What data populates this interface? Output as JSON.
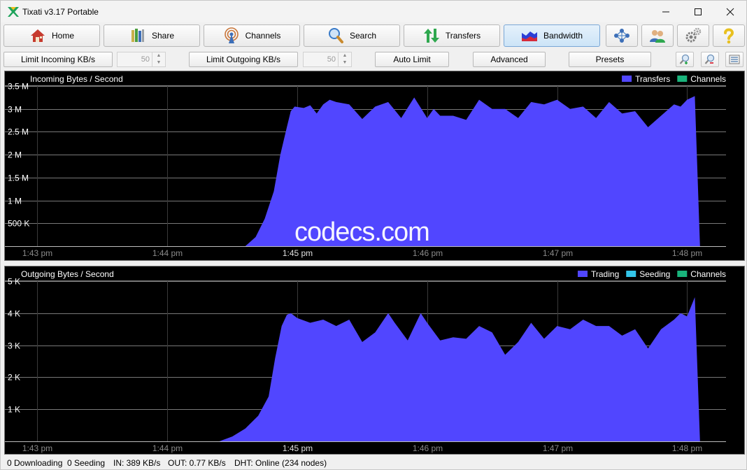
{
  "window": {
    "title": "Tixati v3.17 Portable"
  },
  "toolbar": {
    "buttons": [
      {
        "label": "Home",
        "icon": "house-icon"
      },
      {
        "label": "Share",
        "icon": "books-icon"
      },
      {
        "label": "Channels",
        "icon": "antenna-icon"
      },
      {
        "label": "Search",
        "icon": "magnifier-icon"
      },
      {
        "label": "Transfers",
        "icon": "up-down-arrows-icon"
      },
      {
        "label": "Bandwidth",
        "icon": "bandwidth-chart-icon"
      }
    ],
    "icon_buttons": [
      "network-nodes-icon",
      "users-icon",
      "gears-icon",
      "question-mark-icon"
    ]
  },
  "limits": {
    "incoming_label": "Limit Incoming KB/s",
    "incoming_value": "50",
    "outgoing_label": "Limit Outgoing KB/s",
    "outgoing_value": "50",
    "auto_label": "Auto Limit",
    "advanced_label": "Advanced",
    "presets_label": "Presets"
  },
  "watermark": "codecs.com",
  "colors": {
    "trading": "#5146ff",
    "transfers": "#5146ff",
    "seeding": "#33c5e9",
    "channels": "#19b37b",
    "graph_bg": "#000000",
    "gridline": "#a0a0a0"
  },
  "chart_data": [
    {
      "type": "area",
      "title": "Incoming Bytes / Second",
      "legend": [
        {
          "name": "Transfers",
          "color": "#5146ff"
        },
        {
          "name": "Channels",
          "color": "#19b37b"
        }
      ],
      "legend_position": "top-right",
      "y_ticks": [
        "500 K",
        "1 M",
        "1.5 M",
        "2 M",
        "2.5 M",
        "3 M",
        "3.5 M"
      ],
      "y_tick_values": [
        500000,
        1000000,
        1500000,
        2000000,
        2500000,
        3000000,
        3500000
      ],
      "ylim": [
        0,
        3500000
      ],
      "x_ticks": [
        "1:43 pm",
        "1:44 pm",
        "1:45 pm",
        "1:46 pm",
        "1:47 pm",
        "1:48 pm"
      ],
      "x_minutes": [
        0,
        1,
        2,
        3,
        4,
        5
      ],
      "xlim": [
        -0.25,
        5.3
      ],
      "series": [
        {
          "name": "Transfers",
          "x": [
            -0.25,
            1.6,
            1.68,
            1.75,
            1.82,
            1.87,
            1.92,
            1.95,
            1.98,
            2.05,
            2.1,
            2.15,
            2.2,
            2.25,
            2.3,
            2.4,
            2.5,
            2.6,
            2.7,
            2.8,
            2.9,
            3.0,
            3.05,
            3.1,
            3.2,
            3.3,
            3.4,
            3.5,
            3.6,
            3.7,
            3.8,
            3.9,
            4.0,
            4.1,
            4.2,
            4.3,
            4.4,
            4.5,
            4.6,
            4.7,
            4.8,
            4.9,
            4.95,
            5.0,
            5.06,
            5.1,
            5.3
          ],
          "y": [
            0,
            0,
            200000,
            600000,
            1200000,
            2000000,
            2600000,
            2950000,
            3050000,
            3020000,
            3080000,
            2900000,
            3100000,
            3200000,
            3150000,
            3100000,
            2780000,
            3050000,
            3150000,
            2800000,
            3250000,
            2800000,
            3000000,
            2850000,
            2850000,
            2760000,
            3200000,
            3000000,
            3000000,
            2800000,
            3150000,
            3100000,
            3200000,
            3000000,
            3050000,
            2800000,
            3150000,
            2900000,
            2950000,
            2600000,
            2850000,
            3100000,
            3050000,
            3200000,
            3280000,
            0,
            0
          ]
        },
        {
          "name": "Channels",
          "x": [
            -0.25,
            5.3
          ],
          "y": [
            0,
            0
          ]
        }
      ]
    },
    {
      "type": "area",
      "title": "Outgoing Bytes / Second",
      "legend": [
        {
          "name": "Trading",
          "color": "#5146ff"
        },
        {
          "name": "Seeding",
          "color": "#33c5e9"
        },
        {
          "name": "Channels",
          "color": "#19b37b"
        }
      ],
      "legend_position": "top-right",
      "y_ticks": [
        "1 K",
        "2 K",
        "3 K",
        "4 K",
        "5 K"
      ],
      "y_tick_values": [
        1000,
        2000,
        3000,
        4000,
        5000
      ],
      "ylim": [
        0,
        5000
      ],
      "x_ticks": [
        "1:43 pm",
        "1:44 pm",
        "1:45 pm",
        "1:46 pm",
        "1:47 pm",
        "1:48 pm"
      ],
      "x_minutes": [
        0,
        1,
        2,
        3,
        4,
        5
      ],
      "xlim": [
        -0.25,
        5.3
      ],
      "series": [
        {
          "name": "Trading",
          "x": [
            -0.25,
            0.5,
            1.4,
            1.5,
            1.6,
            1.7,
            1.78,
            1.83,
            1.88,
            1.92,
            1.95,
            2.0,
            2.1,
            2.2,
            2.3,
            2.4,
            2.5,
            2.6,
            2.7,
            2.75,
            2.85,
            2.95,
            3.0,
            3.1,
            3.2,
            3.3,
            3.4,
            3.5,
            3.6,
            3.7,
            3.8,
            3.9,
            4.0,
            4.1,
            4.2,
            4.3,
            4.4,
            4.5,
            4.6,
            4.7,
            4.8,
            4.9,
            4.95,
            5.0,
            5.06,
            5.1,
            5.3
          ],
          "y": [
            0,
            0,
            0,
            150,
            400,
            800,
            1400,
            2600,
            3600,
            3950,
            4000,
            3850,
            3700,
            3800,
            3600,
            3800,
            3100,
            3400,
            4000,
            3700,
            3150,
            4000,
            3700,
            3150,
            3250,
            3200,
            3600,
            3400,
            2700,
            3100,
            3700,
            3200,
            3600,
            3500,
            3800,
            3600,
            3600,
            3300,
            3500,
            2900,
            3500,
            3800,
            4000,
            3900,
            4500,
            0,
            0
          ]
        },
        {
          "name": "Seeding",
          "x": [
            -0.25,
            5.3
          ],
          "y": [
            0,
            0
          ]
        },
        {
          "name": "Channels",
          "x": [
            -0.25,
            5.3
          ],
          "y": [
            0,
            0
          ]
        }
      ]
    }
  ],
  "status": {
    "downloading": "0 Downloading",
    "seeding": "0 Seeding",
    "in": "IN: 389 KB/s",
    "out": "OUT: 0.77 KB/s",
    "dht": "DHT: Online (234 nodes)"
  }
}
